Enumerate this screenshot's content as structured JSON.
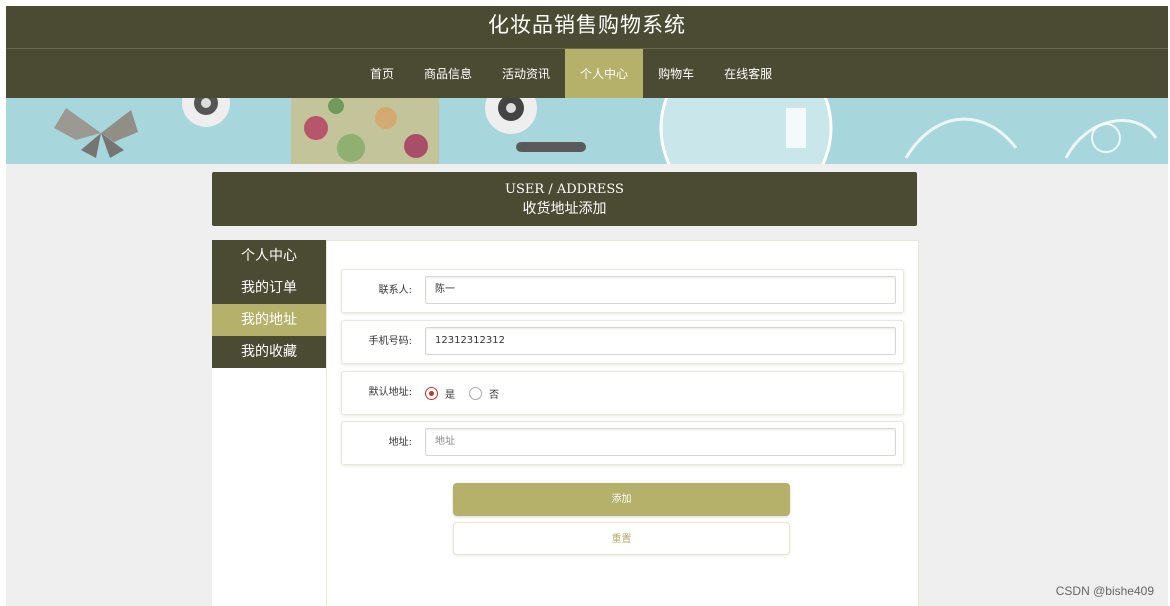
{
  "app": {
    "title": "化妆品销售购物系统"
  },
  "nav": {
    "items": [
      {
        "label": "首页"
      },
      {
        "label": "商品信息"
      },
      {
        "label": "活动资讯"
      },
      {
        "label": "个人中心",
        "active": true
      },
      {
        "label": "购物车"
      },
      {
        "label": "在线客服"
      }
    ]
  },
  "page": {
    "title_en": "USER / ADDRESS",
    "title_cn": "收货地址添加"
  },
  "sidebar": {
    "items": [
      {
        "label": "个人中心"
      },
      {
        "label": "我的订单"
      },
      {
        "label": "我的地址",
        "active": true
      },
      {
        "label": "我的收藏"
      }
    ]
  },
  "form": {
    "contact": {
      "label": "联系人:",
      "value": "陈一"
    },
    "phone": {
      "label": "手机号码:",
      "value": "12312312312"
    },
    "default": {
      "label": "默认地址:",
      "options": [
        "是",
        "否"
      ],
      "selected": "是"
    },
    "address": {
      "label": "地址:",
      "placeholder": "地址"
    },
    "submit_label": "添加",
    "reset_label": "重置"
  },
  "watermark": "CSDN @bishe409",
  "colors": {
    "dark_olive": "#4b4a32",
    "accent": "#b5b06a",
    "radio_checked": "#c0392b"
  }
}
